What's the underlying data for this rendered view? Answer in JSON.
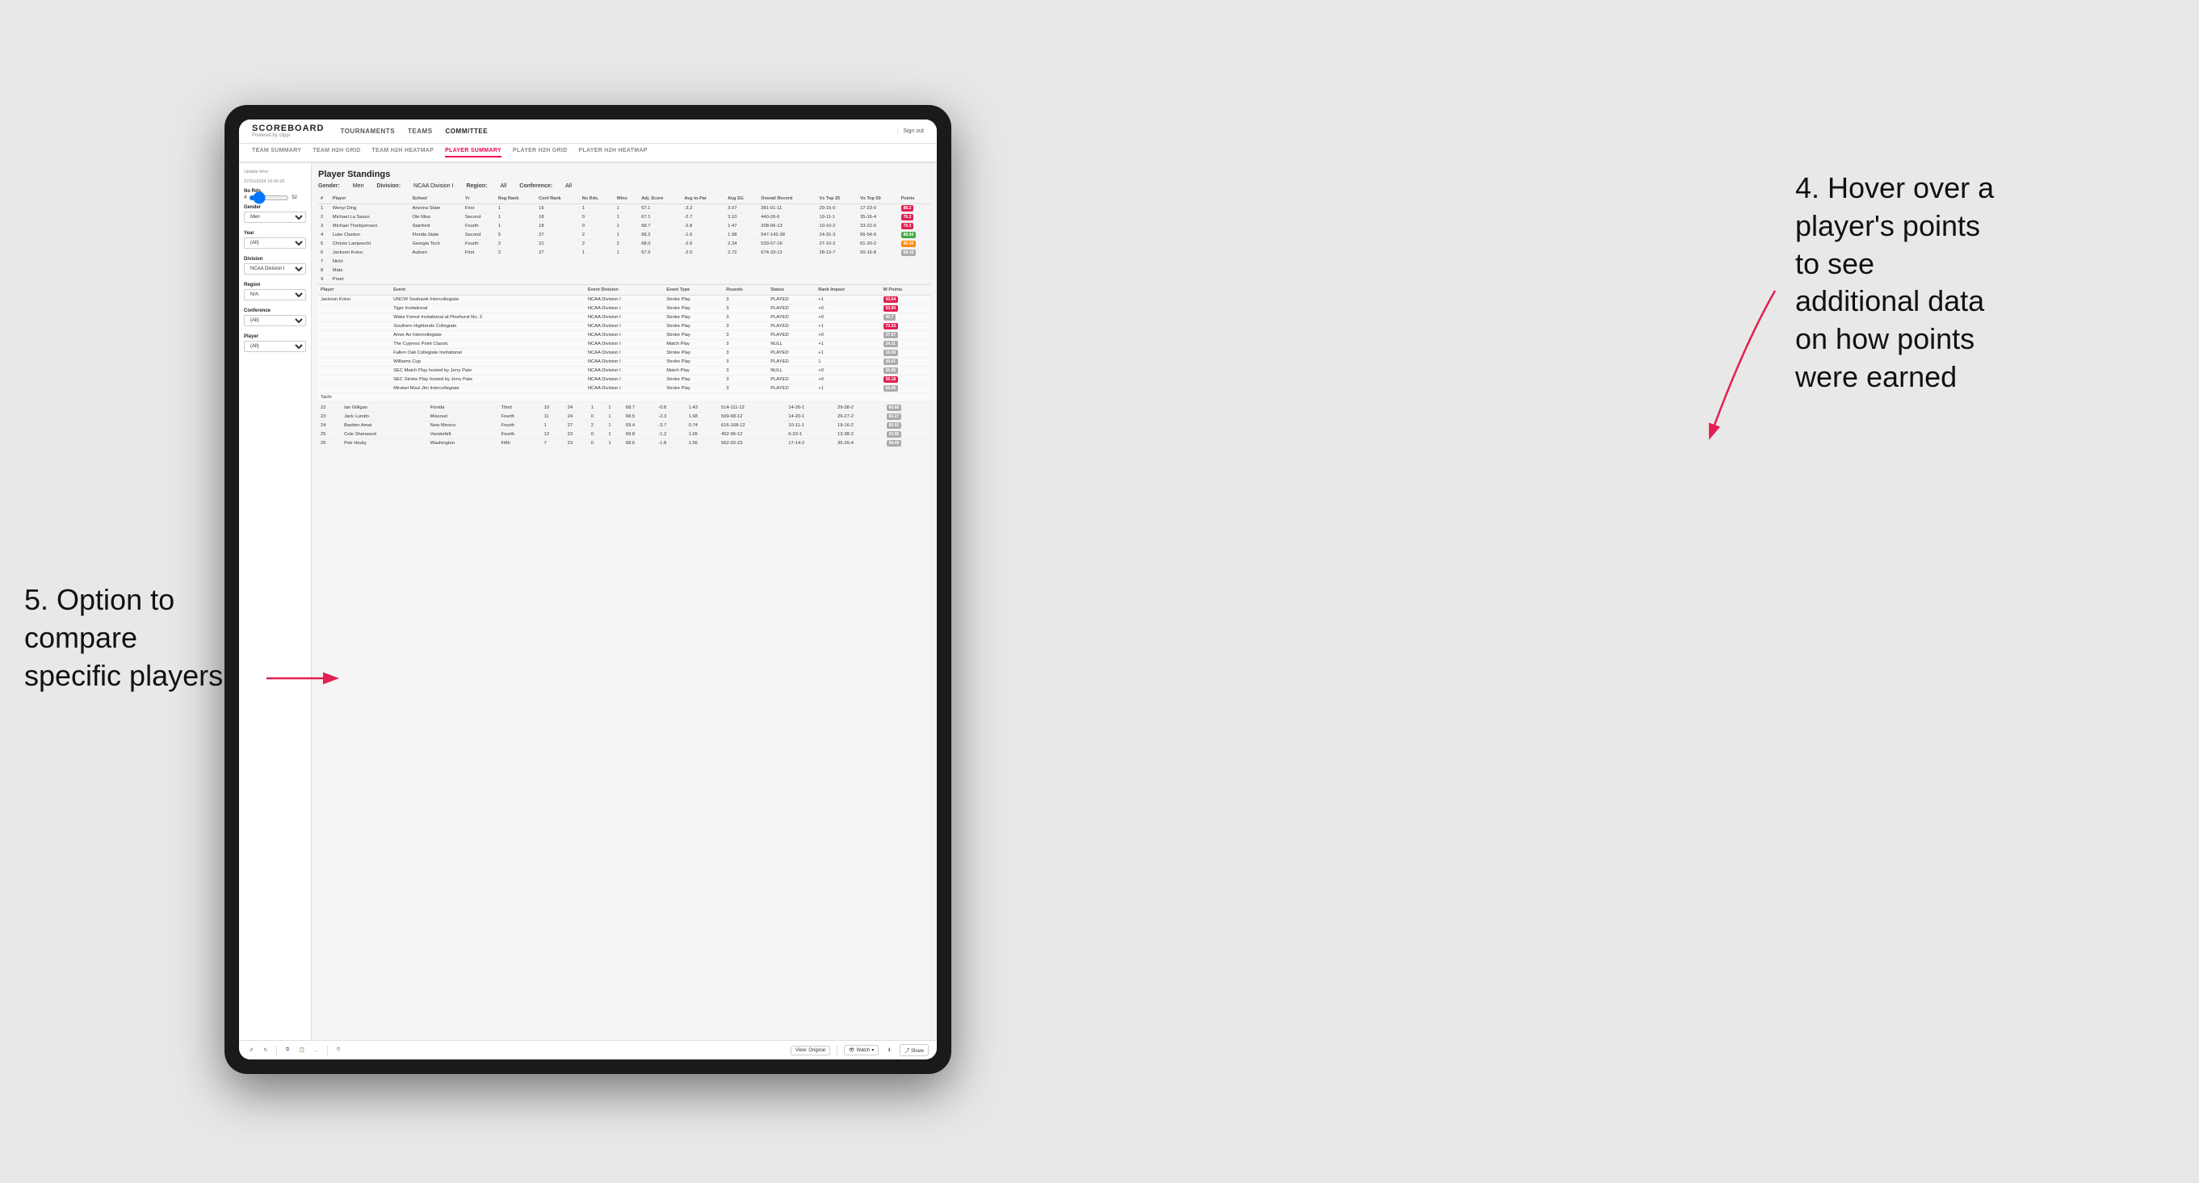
{
  "app": {
    "logo": "SCOREBOARD",
    "logo_sub": "Powered by clippi",
    "sign_out": "Sign out"
  },
  "nav": {
    "items": [
      {
        "label": "TOURNAMENTS",
        "active": false
      },
      {
        "label": "TEAMS",
        "active": false
      },
      {
        "label": "COMMITTEE",
        "active": true
      }
    ]
  },
  "sub_nav": {
    "items": [
      {
        "label": "TEAM SUMMARY",
        "active": false
      },
      {
        "label": "TEAM H2H GRID",
        "active": false
      },
      {
        "label": "TEAM H2H HEATMAP",
        "active": false
      },
      {
        "label": "PLAYER SUMMARY",
        "active": true
      },
      {
        "label": "PLAYER H2H GRID",
        "active": false
      },
      {
        "label": "PLAYER H2H HEATMAP",
        "active": false
      }
    ]
  },
  "sidebar": {
    "update_time_label": "Update time:",
    "update_time": "27/01/2024 16:56:26",
    "no_rds_label": "No Rds.",
    "no_rds_min": "4",
    "no_rds_max": "52",
    "gender_label": "Gender",
    "gender_value": "Men",
    "year_label": "Year",
    "year_value": "(All)",
    "division_label": "Division",
    "division_value": "NCAA Division I",
    "region_label": "Region",
    "region_value": "N/A",
    "conference_label": "Conference",
    "conference_value": "(All)",
    "player_label": "Player",
    "player_value": "(All)"
  },
  "main": {
    "title": "Player Standings",
    "filters": {
      "gender_label": "Gender:",
      "gender_value": "Men",
      "division_label": "Division:",
      "division_value": "NCAA Division I",
      "region_label": "Region:",
      "region_value": "All",
      "conference_label": "Conference:",
      "conference_value": "All"
    },
    "table_headers": [
      "#",
      "Player",
      "School",
      "Yr",
      "Reg Rank",
      "Conf Rank",
      "No Rds.",
      "Wins",
      "Adj. Score",
      "Avg to-Par",
      "Avg SG",
      "Overall Record",
      "Vs Top 25",
      "Vs Top 50",
      "Points"
    ],
    "rows": [
      {
        "rank": "1",
        "player": "Wenyi Ding",
        "school": "Arizona State",
        "yr": "First",
        "reg_rank": "1",
        "conf_rank": "15",
        "no_rds": "1",
        "wins": "1",
        "adj_score": "67.1",
        "to_par": "-3.2",
        "avg_sg": "3.07",
        "record": "381-01-11",
        "vs_top25": "29-15-0",
        "vs_top50": "17-23-0",
        "points": "88.2",
        "points_color": "red"
      },
      {
        "rank": "2",
        "player": "Michael La Sasso",
        "school": "Ole Miss",
        "yr": "Second",
        "reg_rank": "1",
        "conf_rank": "18",
        "no_rds": "0",
        "wins": "1",
        "adj_score": "67.1",
        "to_par": "-2.7",
        "avg_sg": "3.10",
        "record": "440-26-6",
        "vs_top25": "19-11-1",
        "vs_top50": "35-16-4",
        "points": "76.2",
        "points_color": "red"
      },
      {
        "rank": "3",
        "player": "Michael Thorbjornsen",
        "school": "Stanford",
        "yr": "Fourth",
        "reg_rank": "1",
        "conf_rank": "18",
        "no_rds": "0",
        "wins": "1",
        "adj_score": "68.7",
        "to_par": "-2.8",
        "avg_sg": "1.47",
        "record": "208-06-13",
        "vs_top25": "10-10-2",
        "vs_top50": "23-22-0",
        "points": "70.2",
        "points_color": "red"
      },
      {
        "rank": "4",
        "player": "Luke Clanton",
        "school": "Florida State",
        "yr": "Second",
        "reg_rank": "5",
        "conf_rank": "27",
        "no_rds": "2",
        "wins": "1",
        "adj_score": "68.2",
        "to_par": "-1.6",
        "avg_sg": "1.98",
        "record": "547-142-38",
        "vs_top25": "24-31-3",
        "vs_top50": "65-54-6",
        "points": "88.94",
        "points_color": "green"
      },
      {
        "rank": "5",
        "player": "Christo Lamprecht",
        "school": "Georgia Tech",
        "yr": "Fourth",
        "reg_rank": "2",
        "conf_rank": "21",
        "no_rds": "2",
        "wins": "2",
        "adj_score": "68.0",
        "to_par": "-2.6",
        "avg_sg": "2.34",
        "record": "533-57-16",
        "vs_top25": "27-10-2",
        "vs_top50": "61-20-2",
        "points": "80.09",
        "points_color": "orange"
      },
      {
        "rank": "6",
        "player": "Jackson Koivu",
        "school": "Auburn",
        "yr": "First",
        "reg_rank": "2",
        "conf_rank": "27",
        "no_rds": "1",
        "wins": "1",
        "adj_score": "67.5",
        "to_par": "-2.0",
        "avg_sg": "2.72",
        "record": "674-33-12",
        "vs_top25": "28-12-7",
        "vs_top50": "50-16-8",
        "points": "68.18",
        "points_color": "normal"
      },
      {
        "rank": "7",
        "player": "Nichi",
        "school": "",
        "yr": "",
        "reg_rank": "",
        "conf_rank": "",
        "no_rds": "",
        "wins": "",
        "adj_score": "",
        "to_par": "",
        "avg_sg": "",
        "record": "",
        "vs_top25": "",
        "vs_top50": "",
        "points": "",
        "points_color": "normal"
      },
      {
        "rank": "8",
        "player": "Mats",
        "school": "",
        "yr": "",
        "reg_rank": "",
        "conf_rank": "",
        "no_rds": "",
        "wins": "",
        "adj_score": "",
        "to_par": "",
        "avg_sg": "",
        "record": "",
        "vs_top25": "",
        "vs_top50": "",
        "points": "",
        "points_color": "normal"
      },
      {
        "rank": "9",
        "player": "Prest",
        "school": "",
        "yr": "",
        "reg_rank": "",
        "conf_rank": "",
        "no_rds": "",
        "wins": "",
        "adj_score": "",
        "to_par": "",
        "avg_sg": "",
        "record": "",
        "vs_top25": "",
        "vs_top50": "",
        "points": "",
        "points_color": "normal"
      }
    ],
    "detail_headers": [
      "Player",
      "Event",
      "Event Division",
      "Event Type",
      "Rounds",
      "Status",
      "Rank Impact",
      "W Points"
    ],
    "detail_rows": [
      {
        "player": "Jackson Koivu",
        "event": "UNCW Seahawk Intercollegiate",
        "division": "NCAA Division I",
        "type": "Stroke Play",
        "rounds": "3",
        "status": "PLAYED",
        "rank_impact": "+1",
        "w_points": "43.64",
        "points_color": "red"
      },
      {
        "player": "",
        "event": "Tiger Invitational",
        "division": "NCAA Division I",
        "type": "Stroke Play",
        "rounds": "3",
        "status": "PLAYED",
        "rank_impact": "+0",
        "w_points": "53.60",
        "points_color": "red"
      },
      {
        "player": "",
        "event": "Wake Forest Invitational at Pinehurst No. 2",
        "division": "NCAA Division I",
        "type": "Stroke Play",
        "rounds": "3",
        "status": "PLAYED",
        "rank_impact": "+0",
        "w_points": "40.7",
        "points_color": "normal"
      },
      {
        "player": "",
        "event": "Southern Highlands Collegiate",
        "division": "NCAA Division I",
        "type": "Stroke Play",
        "rounds": "3",
        "status": "PLAYED",
        "rank_impact": "+1",
        "w_points": "73.33",
        "points_color": "red"
      },
      {
        "player": "",
        "event": "Amer An Intercollegiate",
        "division": "NCAA Division I",
        "type": "Stroke Play",
        "rounds": "3",
        "status": "PLAYED",
        "rank_impact": "+0",
        "w_points": "37.57",
        "points_color": "normal"
      },
      {
        "player": "",
        "event": "The Cypress Point Classic",
        "division": "NCAA Division I",
        "type": "Match Play",
        "rounds": "3",
        "status": "NULL",
        "rank_impact": "+1",
        "w_points": "24.11",
        "points_color": "normal"
      },
      {
        "player": "",
        "event": "Fallen Oak Collegiate Invitational",
        "division": "NCAA Division I",
        "type": "Stroke Play",
        "rounds": "3",
        "status": "PLAYED",
        "rank_impact": "+1",
        "w_points": "16.90",
        "points_color": "normal"
      },
      {
        "player": "",
        "event": "Williams Cup",
        "division": "NCAA Division I",
        "type": "Stroke Play",
        "rounds": "3",
        "status": "PLAYED",
        "rank_impact": "1",
        "w_points": "30.47",
        "points_color": "normal"
      },
      {
        "player": "",
        "event": "SEC Match Play hosted by Jerry Pate",
        "division": "NCAA Division I",
        "type": "Match Play",
        "rounds": "3",
        "status": "NULL",
        "rank_impact": "+0",
        "w_points": "25.90",
        "points_color": "normal"
      },
      {
        "player": "",
        "event": "SEC Stroke Play hosted by Jerry Pate",
        "division": "NCAA Division I",
        "type": "Stroke Play",
        "rounds": "3",
        "status": "PLAYED",
        "rank_impact": "+0",
        "w_points": "56.18",
        "points_color": "red"
      },
      {
        "player": "",
        "event": "Mirabel Maui Jim Intercollegiate",
        "division": "NCAA Division I",
        "type": "Stroke Play",
        "rounds": "3",
        "status": "PLAYED",
        "rank_impact": "+1",
        "w_points": "66.40",
        "points_color": "normal"
      },
      {
        "player": "Tachi",
        "event": "",
        "division": "",
        "type": "",
        "rounds": "",
        "status": "",
        "rank_impact": "",
        "w_points": "",
        "points_color": "normal"
      }
    ],
    "bottom_rows": [
      {
        "rank": "22",
        "player": "Ian Gilligan",
        "school": "Florida",
        "yr": "Third",
        "reg_rank": "10",
        "conf_rank": "24",
        "no_rds": "1",
        "wins": "1",
        "adj_score": "68.7",
        "to_par": "-0.8",
        "avg_sg": "1.43",
        "record": "514-111-12",
        "vs_top25": "14-26-1",
        "vs_top50": "29-38-2",
        "points": "60.68",
        "points_color": "normal"
      },
      {
        "rank": "23",
        "player": "Jack Lundin",
        "school": "Missouri",
        "yr": "Fourth",
        "reg_rank": "11",
        "conf_rank": "24",
        "no_rds": "0",
        "wins": "1",
        "adj_score": "68.5",
        "to_par": "-2.3",
        "avg_sg": "1.68",
        "record": "509-68-12",
        "vs_top25": "14-20-1",
        "vs_top50": "26-27-2",
        "points": "60.27",
        "points_color": "normal"
      },
      {
        "rank": "24",
        "player": "Bastien Amat",
        "school": "New Mexico",
        "yr": "Fourth",
        "reg_rank": "1",
        "conf_rank": "27",
        "no_rds": "2",
        "wins": "1",
        "adj_score": "69.4",
        "to_par": "-3.7",
        "avg_sg": "0.74",
        "record": "616-168-12",
        "vs_top25": "10-11-1",
        "vs_top50": "19-16-2",
        "points": "60.02",
        "points_color": "normal"
      },
      {
        "rank": "25",
        "player": "Cole Sherwood",
        "school": "Vanderbilt",
        "yr": "Fourth",
        "reg_rank": "12",
        "conf_rank": "23",
        "no_rds": "0",
        "wins": "1",
        "adj_score": "69.8",
        "to_par": "-1.2",
        "avg_sg": "1.65",
        "record": "452-96-12",
        "vs_top25": "6-23-1",
        "vs_top50": "13-38-2",
        "points": "59.95",
        "points_color": "normal"
      },
      {
        "rank": "26",
        "player": "Petr Hruby",
        "school": "Washington",
        "yr": "Fifth",
        "reg_rank": "7",
        "conf_rank": "23",
        "no_rds": "0",
        "wins": "1",
        "adj_score": "68.6",
        "to_par": "-1.8",
        "avg_sg": "1.56",
        "record": "562-02-23",
        "vs_top25": "17-14-2",
        "vs_top50": "35-26-4",
        "points": "58.49",
        "points_color": "normal"
      }
    ]
  },
  "toolbar": {
    "view_label": "View: Original",
    "watch_label": "Watch",
    "share_label": "Share"
  },
  "annotations": {
    "right": "4. Hover over a\nplayer's points\nto see\nadditional data\non how points\nwere earned",
    "left": "5. Option to\ncompare\nspecific players"
  }
}
